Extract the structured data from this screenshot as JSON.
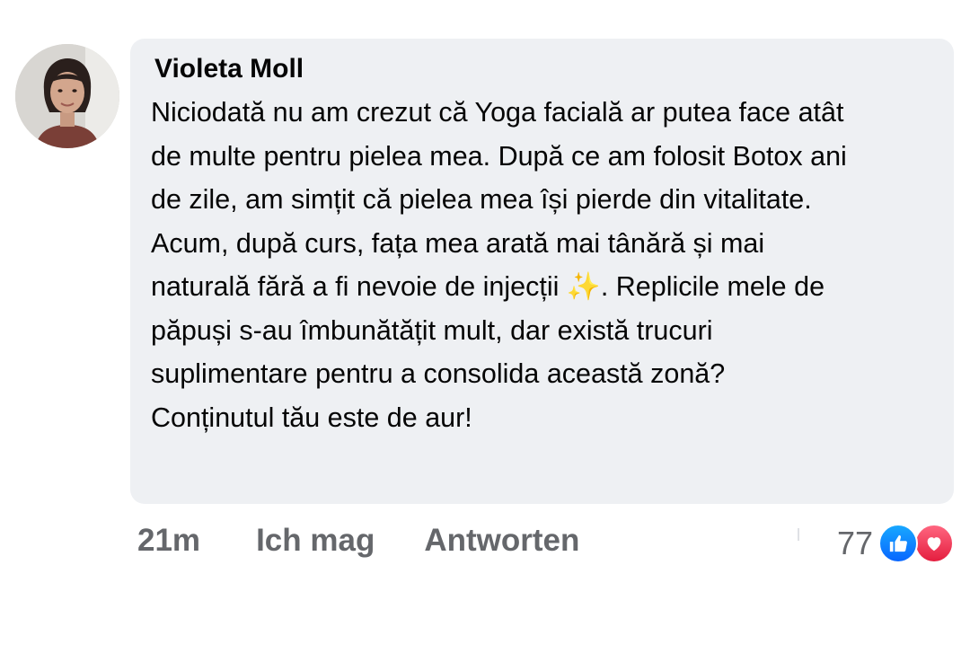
{
  "comment": {
    "author": "Violeta Moll",
    "text": "Niciodată nu am crezut că Yoga facială ar putea face atât\nde multe pentru pielea mea. După ce am folosit Botox ani\nde zile, am simțit că pielea mea își pierde din vitalitate.\nAcum, după curs, fața mea arată mai tânără și mai\nnaturală fără a fi nevoie de injecții ✨. Replicile mele de\npăpuși s-au îmbunătățit mult, dar există trucuri\nsuplimentare pentru a consolida această zonă?\nConținutul tău este de aur!"
  },
  "actions": {
    "time": "21m",
    "like_label": "Ich mag",
    "reply_label": "Antworten"
  },
  "reactions": {
    "count": "77",
    "icons": [
      "like-icon",
      "love-icon"
    ],
    "colors": {
      "like": "#0866ff",
      "love": "#e41e3f"
    }
  },
  "theme": {
    "bubble_bg": "#eef0f3",
    "muted_text": "#65676b"
  }
}
